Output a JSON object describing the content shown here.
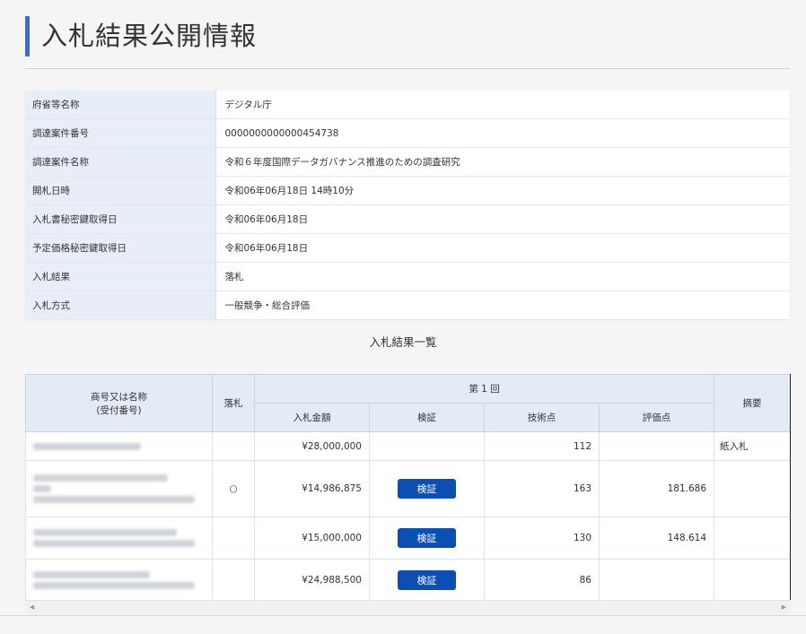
{
  "page": {
    "title": "入札結果公開情報"
  },
  "info": [
    {
      "label": "府省等名称",
      "value": "デジタル庁"
    },
    {
      "label": "調達案件番号",
      "value": "0000000000000454738"
    },
    {
      "label": "調達案件名称",
      "value": "令和６年度国際データガバナンス推進のための調査研究"
    },
    {
      "label": "開札日時",
      "value": "令和06年06月18日 14時10分"
    },
    {
      "label": "入札書秘密鍵取得日",
      "value": "令和06年06月18日"
    },
    {
      "label": "予定価格秘密鍵取得日",
      "value": "令和06年06月18日"
    },
    {
      "label": "入札結果",
      "value": "落札"
    },
    {
      "label": "入札方式",
      "value": "一般競争・総合評価"
    }
  ],
  "results": {
    "section_title": "入札結果一覧",
    "headers": {
      "name": "商号又は名称",
      "name_sub": "(受付番号)",
      "award": "落札",
      "round": "第 1 回",
      "amount": "入札金額",
      "verify": "検証",
      "tech": "技術点",
      "score": "評価点",
      "summary": "摘要"
    },
    "rows": [
      {
        "award": "",
        "amount": "¥28,000,000",
        "verify": "",
        "tech": "112",
        "score": "",
        "summary": "紙入札"
      },
      {
        "award": "○",
        "amount": "¥14,986,875",
        "verify": "検証",
        "tech": "163",
        "score": "181.686",
        "summary": ""
      },
      {
        "award": "",
        "amount": "¥15,000,000",
        "verify": "検証",
        "tech": "130",
        "score": "148.614",
        "summary": ""
      },
      {
        "award": "",
        "amount": "¥24,988,500",
        "verify": "検証",
        "tech": "86",
        "score": "",
        "summary": ""
      }
    ]
  },
  "scrollbar": {
    "left_arrow": "◀",
    "right_arrow": "▶"
  }
}
